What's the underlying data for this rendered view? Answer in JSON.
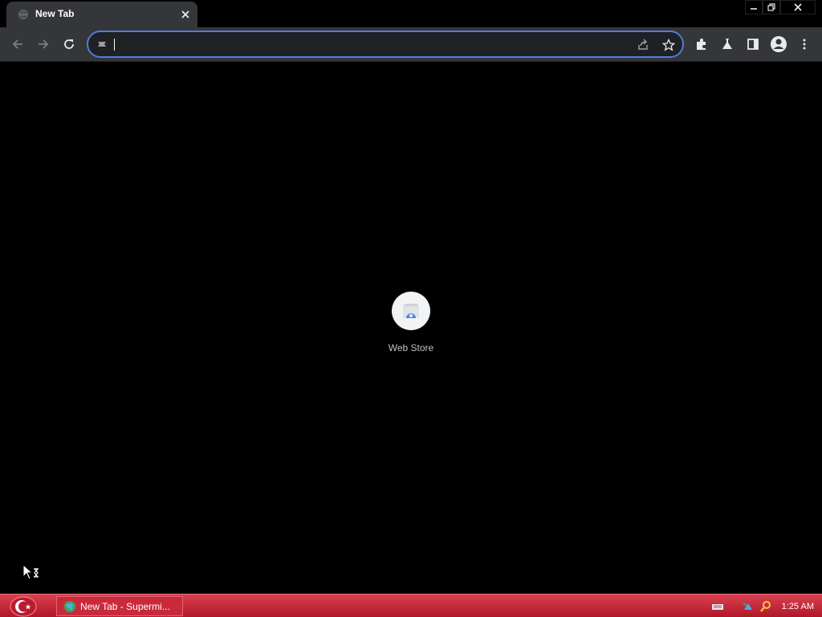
{
  "tabs": [
    {
      "title": "New Tab",
      "active": true
    }
  ],
  "window_controls": {
    "minimize": "minimize-icon",
    "restore": "restore-icon",
    "close": "close-icon"
  },
  "toolbar": {
    "back_icon": "back-arrow-icon",
    "forward_icon": "forward-arrow-icon",
    "reload_icon": "reload-icon",
    "extensions_icon": "puzzle-icon",
    "labs_icon": "flask-icon",
    "side_panel_icon": "side-panel-icon",
    "profile_icon": "account-circle-icon",
    "menu_icon": "kebab-menu-icon"
  },
  "omnibox": {
    "value": "",
    "placeholder": ""
  },
  "shortcuts": [
    {
      "label": "Web Store"
    }
  ],
  "taskbar": {
    "task_label": "New Tab - Supermi...",
    "clock": "1:25 AM"
  },
  "colors": {
    "accent": "#4e7fd8",
    "toolbar": "#35363a",
    "page_bg": "#000000",
    "taskbar": "#c92a3b"
  }
}
